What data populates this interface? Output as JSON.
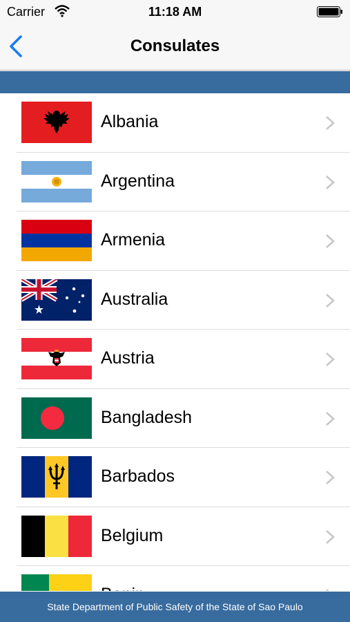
{
  "status": {
    "carrier": "Carrier",
    "time": "11:18 AM"
  },
  "nav": {
    "title": "Consulates"
  },
  "countries": [
    "Albania",
    "Argentina",
    "Armenia",
    "Australia",
    "Austria",
    "Bangladesh",
    "Barbados",
    "Belgium",
    "Benin"
  ],
  "footer": {
    "text": "State Department of Public Safety of the State of Sao Paulo"
  },
  "colors": {
    "accent": "#386b9e",
    "tint": "#1a7cf5"
  },
  "icons": {
    "back": "chevron-left-icon",
    "disclosure": "chevron-right-icon",
    "wifi": "wifi-icon",
    "battery": "battery-icon"
  }
}
